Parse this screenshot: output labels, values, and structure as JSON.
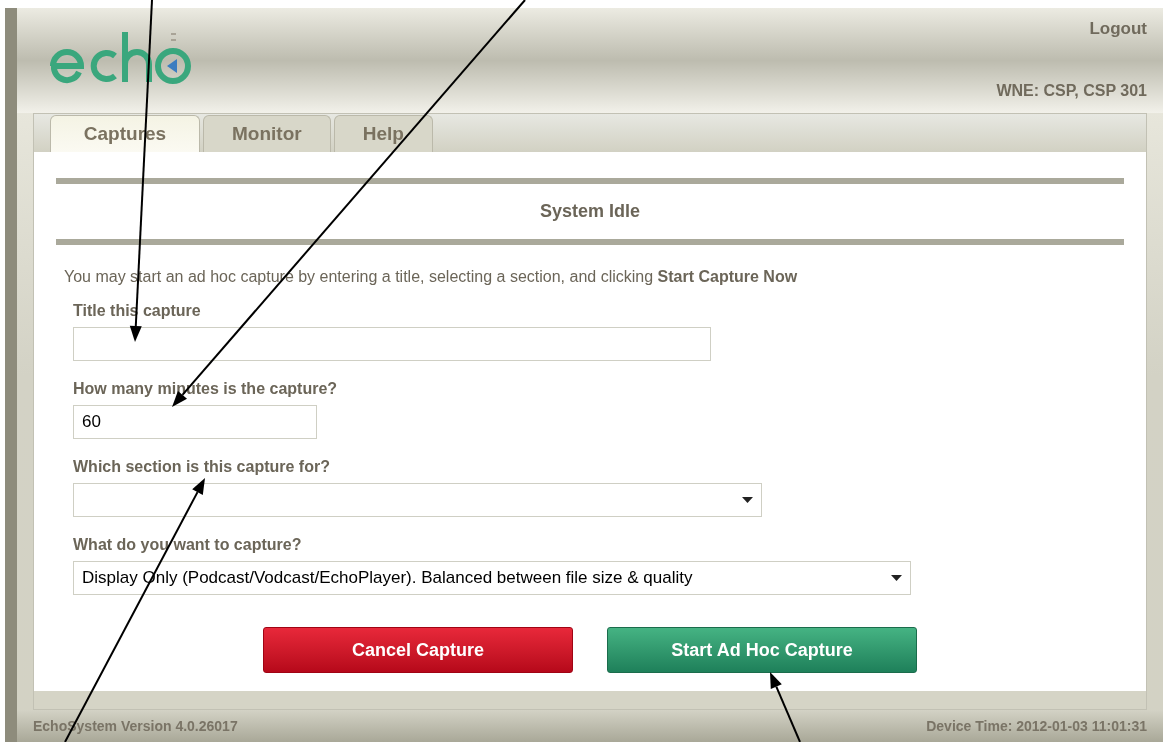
{
  "header": {
    "logout": "Logout",
    "room": "WNE: CSP, CSP 301"
  },
  "tabs": [
    {
      "label": "Captures",
      "selected": true
    },
    {
      "label": "Monitor",
      "selected": false
    },
    {
      "label": "Help",
      "selected": false
    }
  ],
  "status_title": "System Idle",
  "instructions": "You may start an ad hoc capture by entering a title, selecting a section, and clicking **Start Capture Now**",
  "fields": [
    {
      "kind": "text",
      "label": "Title this capture"
    },
    {
      "kind": "short",
      "label": "How many minutes is the capture?",
      "value": "60"
    },
    {
      "kind": "select",
      "label": "Which section is this capture for?"
    },
    {
      "kind": "select-wide",
      "label": "What do you want to capture?",
      "value": "Display Only (Podcast/Vodcast/EchoPlayer). Balanced between file size & quality"
    }
  ],
  "buttons": [
    {
      "kind": "cancel",
      "label": "Cancel Capture"
    },
    {
      "kind": "start",
      "label": "Start Ad Hoc Capture"
    }
  ],
  "footer": {
    "version": "EchoSystem Version 4.0.26017",
    "device_time": "Device Time: 2012-01-03 11:01:31"
  }
}
